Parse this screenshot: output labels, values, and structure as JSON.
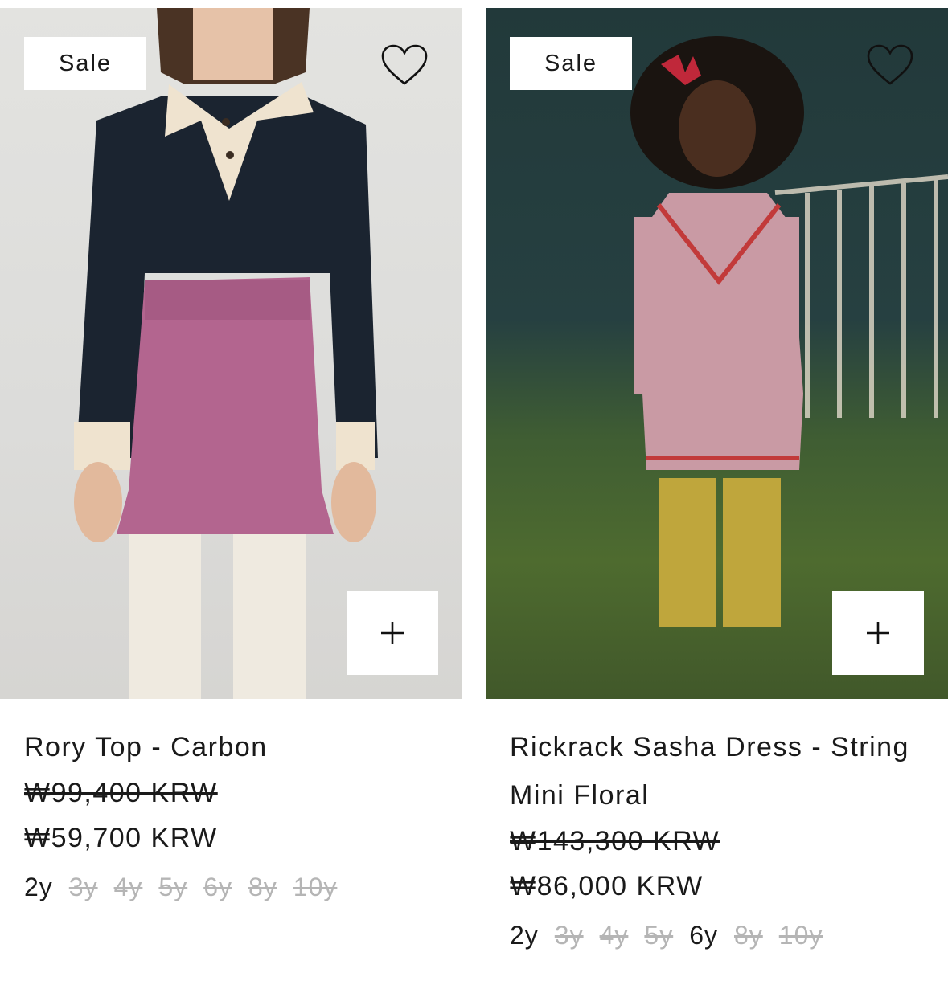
{
  "products": [
    {
      "badge": "Sale",
      "name": "Rory Top - Carbon",
      "old_price": "₩99,400 KRW",
      "new_price": "₩59,700 KRW",
      "add_label": "+",
      "sizes": [
        {
          "label": "2y",
          "available": true
        },
        {
          "label": "3y",
          "available": false
        },
        {
          "label": "4y",
          "available": false
        },
        {
          "label": "5y",
          "available": false
        },
        {
          "label": "6y",
          "available": false
        },
        {
          "label": "8y",
          "available": false
        },
        {
          "label": "10y",
          "available": false
        }
      ]
    },
    {
      "badge": "Sale",
      "name": "Rickrack Sasha Dress - String Mini Floral",
      "old_price": "₩143,300 KRW",
      "new_price": "₩86,000 KRW",
      "add_label": "+",
      "sizes": [
        {
          "label": "2y",
          "available": true
        },
        {
          "label": "3y",
          "available": false
        },
        {
          "label": "4y",
          "available": false
        },
        {
          "label": "5y",
          "available": false
        },
        {
          "label": "6y",
          "available": true
        },
        {
          "label": "8y",
          "available": false
        },
        {
          "label": "10y",
          "available": false
        }
      ]
    }
  ],
  "icons": {
    "wishlist": "heart-icon",
    "add": "plus-icon"
  },
  "colors": {
    "available_size": "#1a1a1a",
    "unavailable_size": "#b5b5b5"
  }
}
